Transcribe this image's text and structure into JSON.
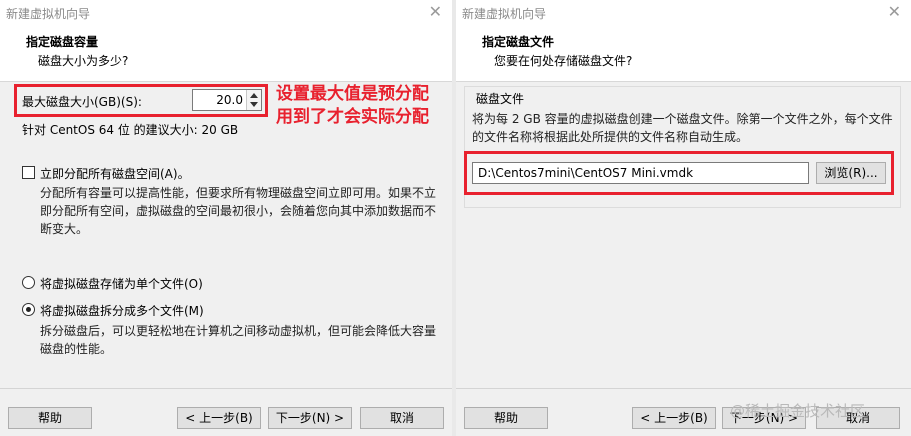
{
  "left": {
    "window_title": "新建虚拟机向导",
    "header_title": "指定磁盘容量",
    "header_subtitle": "磁盘大小为多少?",
    "max_size_label": "最大磁盘大小(GB)(S):",
    "max_size_value": "20.0",
    "recommended_size": "针对 CentOS 64 位 的建议大小: 20 GB",
    "allocate_checkbox_label": "立即分配所有磁盘空间(A)。",
    "allocate_checked": false,
    "allocate_desc_1": "分配所有容量可以提高性能，但要求所有物理磁盘空间立即可用。如果不立",
    "allocate_desc_2": "即分配所有空间，虚拟磁盘的空间最初很小，会随着您向其中添加数据而不",
    "allocate_desc_3": "断变大。",
    "radio_single_label": "将虚拟磁盘存储为单个文件(O)",
    "radio_split_label": "将虚拟磁盘拆分成多个文件(M)",
    "selected_radio": "split",
    "split_desc_1": "拆分磁盘后，可以更轻松地在计算机之间移动虚拟机，但可能会降低大容量",
    "split_desc_2": "磁盘的性能。",
    "annotation_1": "设置最大值是预分配",
    "annotation_2": "用到了才会实际分配",
    "buttons": {
      "help": "帮助",
      "back": "< 上一步(B)",
      "next": "下一步(N) >",
      "cancel": "取消"
    }
  },
  "right": {
    "window_title": "新建虚拟机向导",
    "header_title": "指定磁盘文件",
    "header_subtitle": "您要在何处存储磁盘文件?",
    "group_label": "磁盘文件",
    "desc_1": "将为每 2 GB 容量的虚拟磁盘创建一个磁盘文件。除第一个文件之外，每个文件",
    "desc_2": "的文件名称将根据此处所提供的文件名称自动生成。",
    "file_path": "D:\\Centos7mini\\CentOS7 Mini.vmdk",
    "browse_button": "浏览(R)...",
    "buttons": {
      "help": "帮助",
      "back": "< 上一步(B)",
      "next": "下一步(N) >",
      "cancel": "取消"
    }
  },
  "watermark": "@稀土掘金技术社区",
  "colors": {
    "annotation_red": "#e8212e",
    "dialog_bg": "#f0f0f0",
    "header_bg": "#ffffff"
  },
  "icons": {
    "close": "close-icon",
    "spin_up": "spin-up-icon",
    "spin_down": "spin-down-icon"
  }
}
